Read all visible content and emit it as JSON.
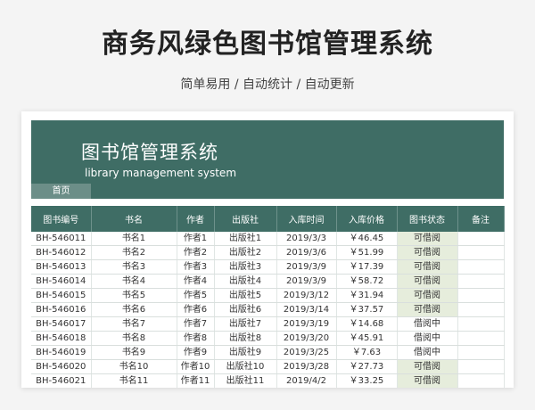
{
  "page": {
    "headline": "商务风绿色图书馆管理系统",
    "subline": "简单易用 / 自动统计 / 自动更新"
  },
  "banner": {
    "title": "图书馆管理系统",
    "subtitle": "library management system",
    "home_tab": "首页"
  },
  "colors": {
    "header_green": "#3f6d65",
    "tab_green": "#6c8e88",
    "available_bg": "#e6eddc"
  },
  "table": {
    "columns": [
      "图书编号",
      "书名",
      "作者",
      "出版社",
      "入库时间",
      "入库价格",
      "图书状态",
      "备注"
    ],
    "rows": [
      [
        "BH-546011",
        "书名1",
        "作者1",
        "出版社1",
        "2019/3/3",
        "￥46.45",
        "可借阅",
        ""
      ],
      [
        "BH-546012",
        "书名2",
        "作者2",
        "出版社2",
        "2019/3/6",
        "￥51.99",
        "可借阅",
        ""
      ],
      [
        "BH-546013",
        "书名3",
        "作者3",
        "出版社3",
        "2019/3/9",
        "￥17.39",
        "可借阅",
        ""
      ],
      [
        "BH-546014",
        "书名4",
        "作者4",
        "出版社4",
        "2019/3/9",
        "￥58.72",
        "可借阅",
        ""
      ],
      [
        "BH-546015",
        "书名5",
        "作者5",
        "出版社5",
        "2019/3/12",
        "￥31.94",
        "可借阅",
        ""
      ],
      [
        "BH-546016",
        "书名6",
        "作者6",
        "出版社6",
        "2019/3/14",
        "￥37.57",
        "可借阅",
        ""
      ],
      [
        "BH-546017",
        "书名7",
        "作者7",
        "出版社7",
        "2019/3/19",
        "￥14.68",
        "借阅中",
        ""
      ],
      [
        "BH-546018",
        "书名8",
        "作者8",
        "出版社8",
        "2019/3/20",
        "￥45.91",
        "借阅中",
        ""
      ],
      [
        "BH-546019",
        "书名9",
        "作者9",
        "出版社9",
        "2019/3/25",
        "￥7.63",
        "借阅中",
        ""
      ],
      [
        "BH-546020",
        "书名10",
        "作者10",
        "出版社10",
        "2019/3/28",
        "￥27.73",
        "可借阅",
        ""
      ],
      [
        "BH-546021",
        "书名11",
        "作者11",
        "出版社11",
        "2019/4/2",
        "￥33.25",
        "可借阅",
        ""
      ]
    ]
  }
}
